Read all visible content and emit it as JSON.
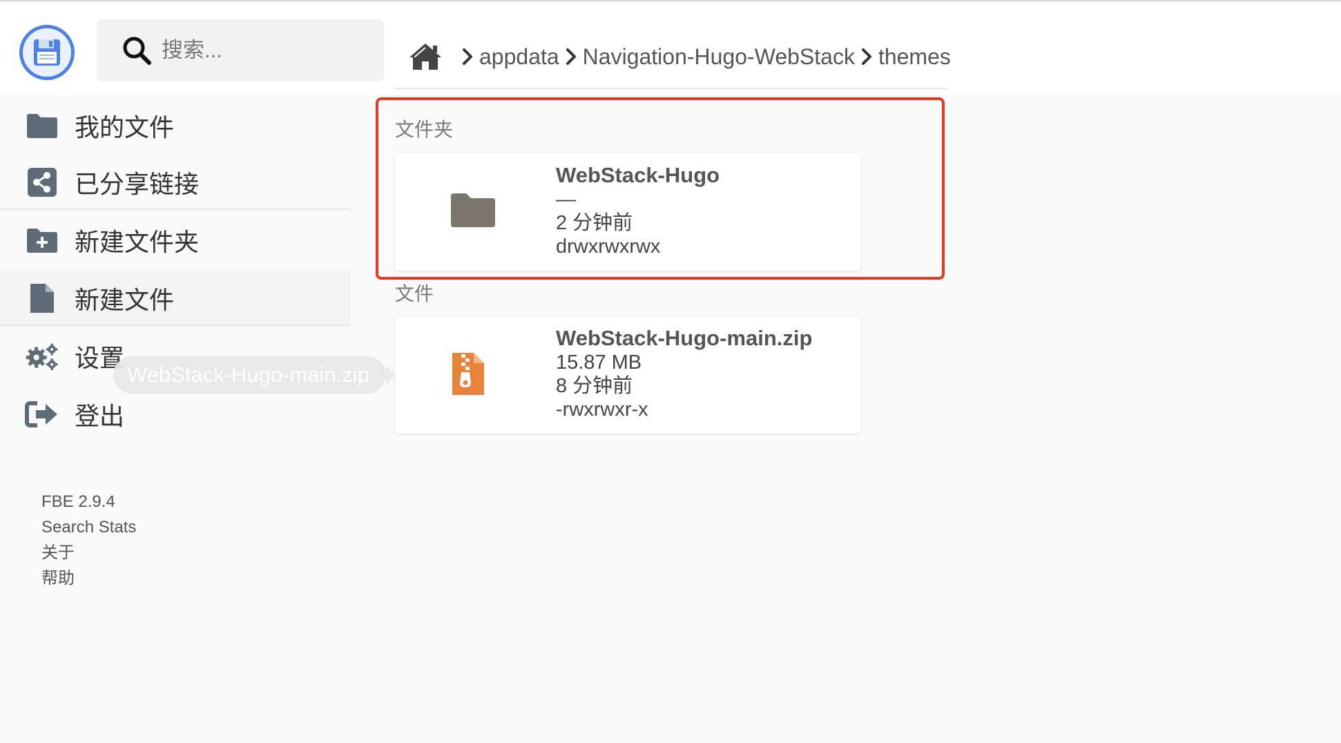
{
  "header": {
    "search": {
      "placeholder": "搜索...",
      "value": ""
    },
    "breadcrumb": [
      "appdata",
      "Navigation-Hugo-WebStack",
      "themes"
    ]
  },
  "sidebar": {
    "items": [
      {
        "label": "我的文件",
        "icon": "folder-icon"
      },
      {
        "label": "已分享链接",
        "icon": "share-icon"
      },
      {
        "label": "新建文件夹",
        "icon": "folder-plus-icon"
      },
      {
        "label": "新建文件",
        "icon": "file-icon"
      },
      {
        "label": "设置",
        "icon": "gears-icon"
      },
      {
        "label": "登出",
        "icon": "sign-out-icon"
      }
    ],
    "footer": [
      "FBE 2.9.4",
      "Search Stats",
      "关于",
      "帮助"
    ]
  },
  "drag_tooltip": "WebStack-Hugo-main.zip",
  "listing": {
    "folders_title": "文件夹",
    "files_title": "文件",
    "folders": [
      {
        "name": "WebStack-Hugo",
        "size": "—",
        "modified": "2 分钟前",
        "permissions": "drwxrwxrwx"
      }
    ],
    "files": [
      {
        "name": "WebStack-Hugo-main.zip",
        "size": "15.87 MB",
        "modified": "8 分钟前",
        "permissions": "-rwxrwxr-x"
      }
    ]
  },
  "colors": {
    "accent": "#4f80e8",
    "highlight": "#e23b22",
    "sidebar_icon": "#5f6b77",
    "folder_icon": "#7e756d",
    "zip_icon": "#e8833a"
  }
}
